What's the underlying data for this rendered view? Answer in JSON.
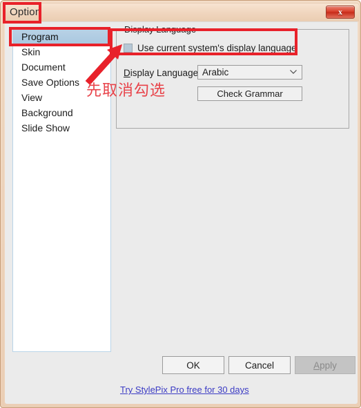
{
  "window": {
    "title": "Option",
    "close_icon": "close-x-icon",
    "close_label": "x"
  },
  "sidebar": {
    "items": [
      {
        "label": "Program",
        "selected": true
      },
      {
        "label": "Skin",
        "selected": false
      },
      {
        "label": "Document",
        "selected": false
      },
      {
        "label": "Save Options",
        "selected": false
      },
      {
        "label": "View",
        "selected": false
      },
      {
        "label": "Background",
        "selected": false
      },
      {
        "label": "Slide Show",
        "selected": false
      }
    ]
  },
  "main": {
    "group_title": "Display Language",
    "checkbox": {
      "label": "Use current system's display language",
      "checked": false,
      "state": "filled-square"
    },
    "language_field": {
      "label_accel": "D",
      "label_rest": "isplay Language:",
      "selected_value": "Arabic",
      "arrow_icon": "chevron-down-icon"
    },
    "check_grammar_label": "Check Grammar"
  },
  "footer": {
    "ok_label": "OK",
    "cancel_label": "Cancel",
    "apply_accel": "A",
    "apply_rest": "pply",
    "apply_enabled": false,
    "trial_link": "Try StylePix Pro free for 30 days"
  },
  "annotations": {
    "note_text": "先取消勾选",
    "highlight_color": "#e8212a",
    "arrow_icon": "red-arrow-icon",
    "boxes": [
      "title-option",
      "sidebar-program",
      "display-language-group"
    ]
  },
  "colors": {
    "titlebar": "#f0d5bd",
    "client": "#ebebeb",
    "selection": "#b0cbe2",
    "link": "#3b3bc4",
    "annotation_red": "#e8212a"
  }
}
